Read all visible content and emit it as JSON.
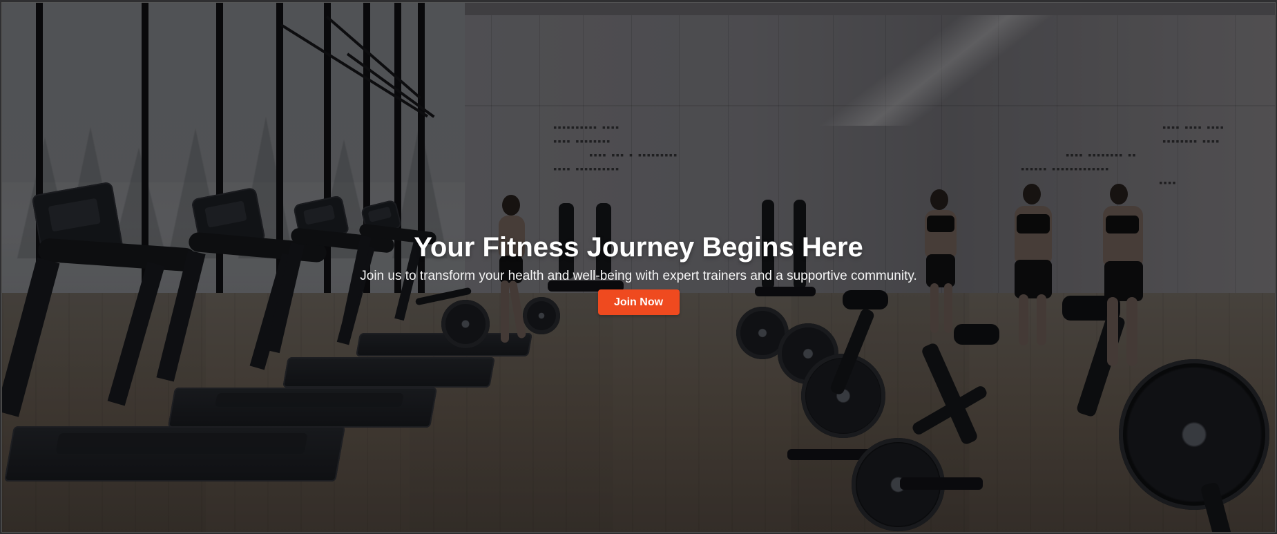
{
  "hero": {
    "title": "Your Fitness Journey Begins Here",
    "subtitle": "Join us to transform your health and well-being with expert trainers and a supportive community.",
    "button_label": "Join Now"
  },
  "colors": {
    "accent": "#ef4a1f",
    "overlay": "rgba(0,0,0,0.43)",
    "text": "#ffffff"
  }
}
